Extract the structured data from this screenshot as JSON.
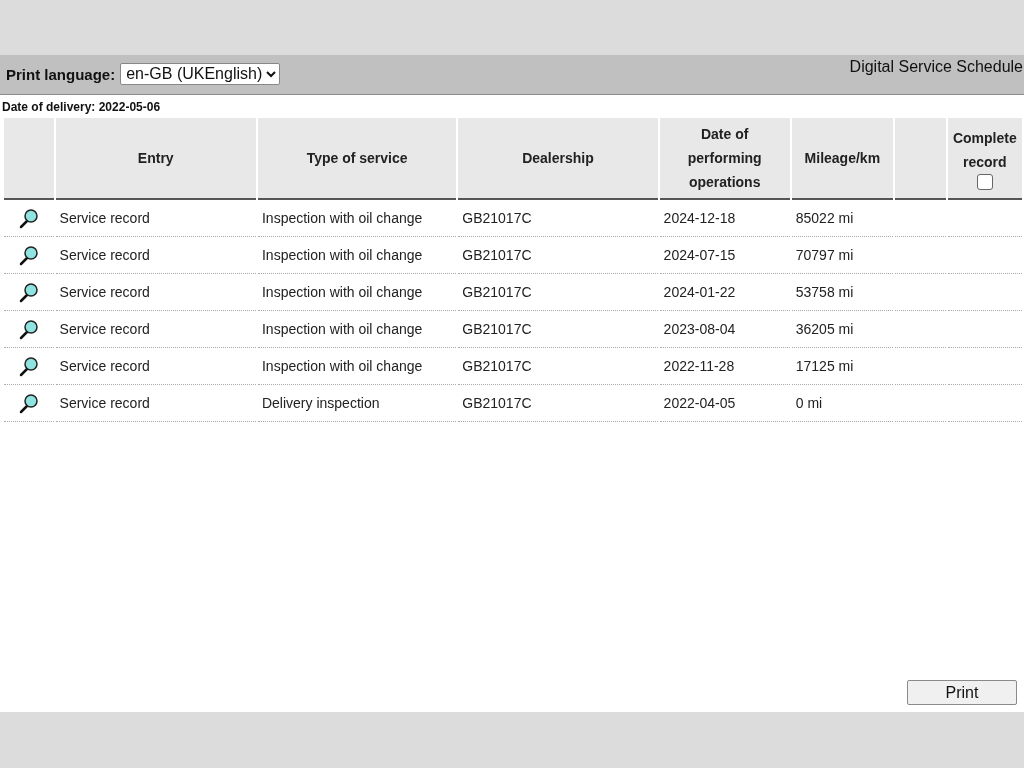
{
  "header": {
    "print_language_label": "Print language:",
    "print_language_value": "en-GB (UKEnglish)",
    "title": "Digital Service Schedule"
  },
  "date_of_delivery": "Date of delivery: 2022-05-06",
  "table": {
    "columns": [
      "Entry",
      "Type of service",
      "Dealership",
      "Date of performing operations",
      "Mileage/km"
    ],
    "complete_record": {
      "label": "Complete record",
      "checked": false
    },
    "rows": [
      {
        "entry": "Service record",
        "type_of_service": "Inspection with oil change",
        "dealership": "GB21017C",
        "date": "2024-12-18",
        "mileage": "85022 mi"
      },
      {
        "entry": "Service record",
        "type_of_service": "Inspection with oil change",
        "dealership": "GB21017C",
        "date": "2024-07-15",
        "mileage": "70797 mi"
      },
      {
        "entry": "Service record",
        "type_of_service": "Inspection with oil change",
        "dealership": "GB21017C",
        "date": "2024-01-22",
        "mileage": "53758 mi"
      },
      {
        "entry": "Service record",
        "type_of_service": "Inspection with oil change",
        "dealership": "GB21017C",
        "date": "2023-08-04",
        "mileage": "36205 mi"
      },
      {
        "entry": "Service record",
        "type_of_service": "Inspection with oil change",
        "dealership": "GB21017C",
        "date": "2022-11-28",
        "mileage": "17125 mi"
      },
      {
        "entry": "Service record",
        "type_of_service": "Delivery inspection",
        "dealership": "GB21017C",
        "date": "2022-04-05",
        "mileage": "0 mi"
      }
    ]
  },
  "print_button": "Print"
}
